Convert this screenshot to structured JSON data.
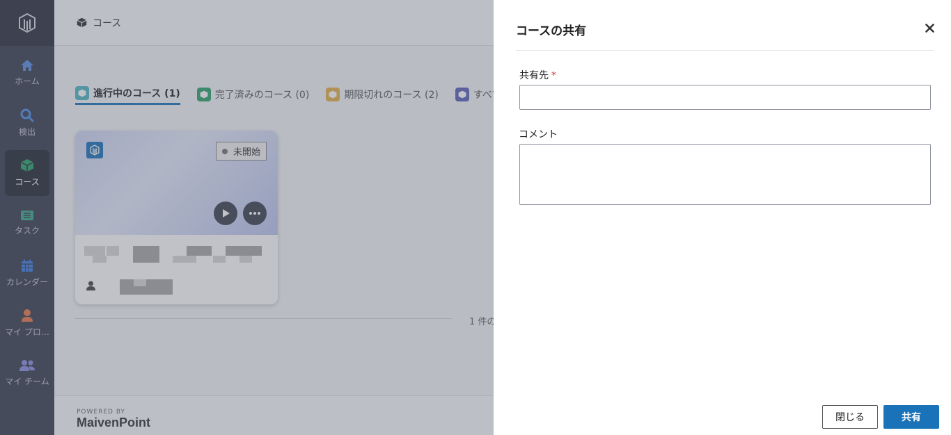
{
  "sidebar": {
    "items": [
      {
        "label": "ホーム",
        "icon": "home-icon"
      },
      {
        "label": "検出",
        "icon": "search-icon"
      },
      {
        "label": "コース",
        "icon": "course-cube-icon",
        "active": true
      },
      {
        "label": "タスク",
        "icon": "task-icon"
      },
      {
        "label": "カレンダー",
        "icon": "calendar-icon"
      },
      {
        "label": "マイ プロ…",
        "icon": "profile-icon"
      },
      {
        "label": "マイ チーム",
        "icon": "team-icon"
      }
    ]
  },
  "header": {
    "title": "コース"
  },
  "tabs": [
    {
      "label": "進行中のコース (1)",
      "active": true,
      "color": "#4fb6c2"
    },
    {
      "label": "完了済みのコース (0)",
      "color": "#2ea36b"
    },
    {
      "label": "期限切れのコース (2)",
      "color": "#e6b24a"
    },
    {
      "label": "すべてのコース",
      "color": "#5c63b8"
    }
  ],
  "card": {
    "status": "未開始"
  },
  "pager": {
    "text": "1 件の"
  },
  "footer": {
    "powered_by": "POWERED BY",
    "brand": "MaivenPoint"
  },
  "panel": {
    "title": "コースの共有",
    "share_to_label": "共有先",
    "required_mark": "*",
    "share_to_value": "",
    "comment_label": "コメント",
    "comment_value": "",
    "close_label": "閉じる",
    "share_label": "共有"
  },
  "colors": {
    "accent": "#1a73b8",
    "sidebar": "#3a3f52",
    "required": "#d0343c"
  }
}
